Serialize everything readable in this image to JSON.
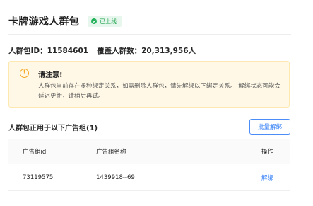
{
  "header": {
    "title": "卡牌游戏人群包",
    "status_badge": "已上线"
  },
  "meta": {
    "package_id_label": "人群包ID：",
    "package_id": "11584601",
    "coverage_label": "覆盖人群数：",
    "coverage": "20,313,956人"
  },
  "notice": {
    "title": "请注意!",
    "body": "人群包当前存在多种绑定关系，如需删除人群包，请先解绑以下绑定关系。 解绑状态可能会延迟更新，请稍后再试。"
  },
  "section": {
    "title": "人群包正用于以下广告组(1)",
    "bulk_unbind_label": "批量解绑"
  },
  "table": {
    "columns": [
      "广告组id",
      "广告组名称",
      "操作"
    ],
    "rows": [
      {
        "id": "73119575",
        "name": "1439918--69",
        "action": "解绑"
      }
    ]
  },
  "colors": {
    "accent": "#2f7cf6",
    "success": "#22b15a",
    "warning": "#f5a623",
    "notice_bg": "#fff8e6"
  }
}
